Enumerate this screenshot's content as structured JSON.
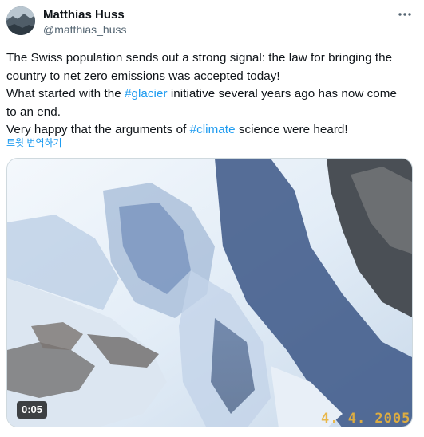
{
  "author": {
    "display_name": "Matthias Huss",
    "handle": "@matthias_huss",
    "avatar_icon": "profile-photo"
  },
  "more_icon": "more-horizontal-icon",
  "tweet": {
    "line1": "The Swiss population sends out a strong signal: the law for bringing the",
    "line2": "country to net zero emissions was accepted today!",
    "line3_before": "What started with the ",
    "line3_hashtag": "#glacier",
    "line3_after": " initiative several years ago has now come",
    "line4": "to an end.",
    "line5_before": "Very happy that the arguments of ",
    "line5_hashtag": "#climate",
    "line5_after": " science were heard!"
  },
  "translate_label": "트윗 번역하기",
  "media": {
    "type": "video",
    "duration": "0:05",
    "date_stamp": "4. 4. 2005"
  },
  "colors": {
    "link": "#1d9bf0",
    "text": "#0f1419",
    "secondary": "#536471"
  }
}
